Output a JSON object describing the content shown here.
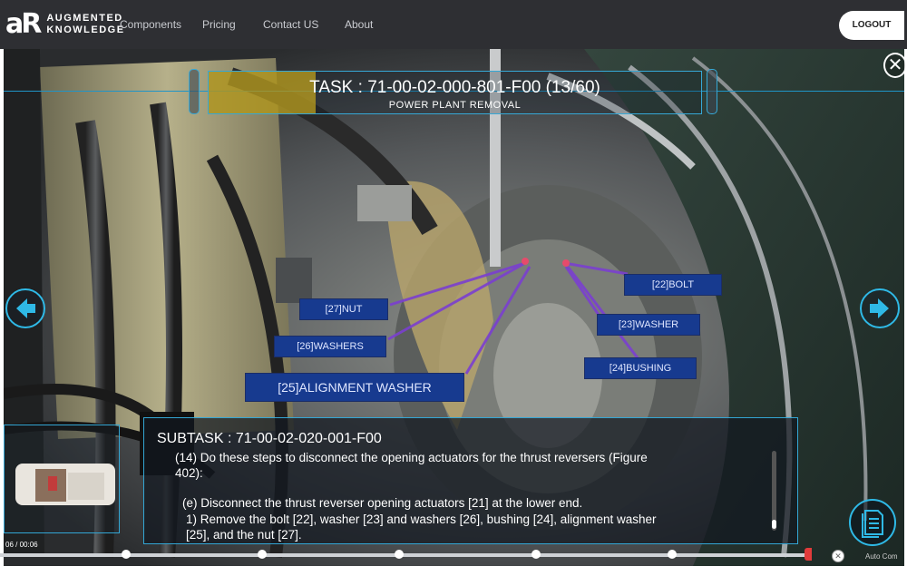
{
  "app": {
    "logo_mark": "aR",
    "logo_line1": "AUGMENTED",
    "logo_line2": "KNOWLEDGE"
  },
  "nav": {
    "items": [
      {
        "label": "Components"
      },
      {
        "label": "Pricing"
      },
      {
        "label": "Contact US"
      },
      {
        "label": "About"
      }
    ],
    "logout_label": "LOGOUT"
  },
  "task": {
    "title": "TASK : 71-00-02-000-801-F00 (13/60)",
    "subtitle": "POWER PLANT REMOVAL",
    "progress": 0.22
  },
  "close_glyph": "✕",
  "labels": {
    "l27": "[27]NUT",
    "l26": "[26]WASHERS",
    "l25": "[25]ALIGNMENT WASHER",
    "l22": "[22]BOLT",
    "l23": "[23]WASHER",
    "l24": "[24]BUSHING"
  },
  "subtask": {
    "title": "SUBTASK : 71-00-02-020-001-F00",
    "lines": [
      "(14) Do these steps to disconnect the opening actuators for the thrust reversers (Figure",
      "402):",
      "(e) Disconnect the thrust reverser opening actuators [21] at the lower end.",
      "1) Remove the bolt [22], washer [23] and washers [26], bushing [24], alignment washer",
      "[25], and the nut [27]."
    ]
  },
  "timeline": {
    "time": "06 / 00:06",
    "auto_label": "Auto Com",
    "position": 1.0
  },
  "colors": {
    "accent": "#2fb9e6",
    "label_bg": "#173a8f",
    "leader": "#7b3fd0",
    "task_fill": "#bea01e",
    "nav_bg": "#2e2f33"
  },
  "icons": {
    "prev": "arrow-left-icon",
    "next": "arrow-right-icon",
    "document": "document-icon",
    "close": "close-icon"
  }
}
